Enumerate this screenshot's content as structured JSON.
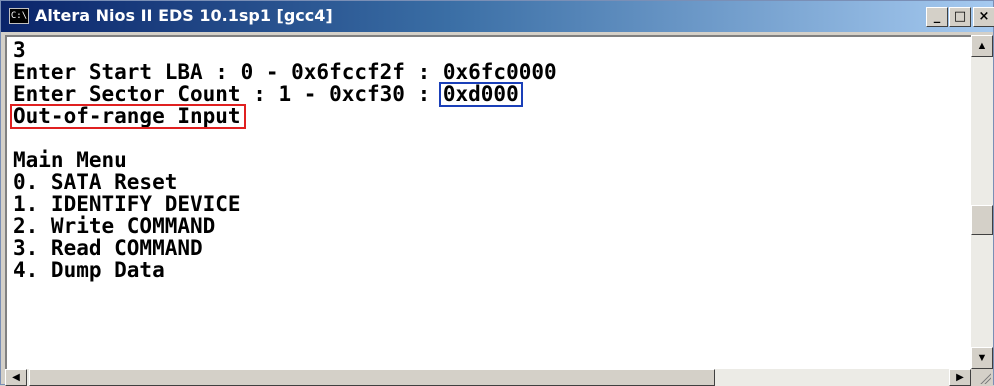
{
  "window": {
    "title": "Altera Nios II EDS 10.1sp1 [gcc4]",
    "icon_text": "C:\\",
    "controls": {
      "minimize": "_",
      "maximize": "□",
      "close": "×"
    }
  },
  "console": {
    "lines": [
      "3",
      "Enter Start LBA : 0 - 0x6fccf2f : 0x6fc0000",
      "Enter Sector Count : 1 - 0xcf30 : 0xd000",
      "Out-of-range Input",
      "",
      "Main Menu",
      "0. SATA Reset",
      "1. IDENTIFY DEVICE",
      "2. Write COMMAND",
      "3. Read COMMAND",
      "4. Dump Data"
    ],
    "highlight_red": "Out-of-range Input",
    "highlight_blue": "0xd000",
    "highlight_colors": {
      "red": "#e02020",
      "blue": "#1a3fb8"
    }
  },
  "scrollbars": {
    "up_icon": "▲",
    "down_icon": "▼",
    "left_icon": "◀",
    "right_icon": "▶"
  }
}
